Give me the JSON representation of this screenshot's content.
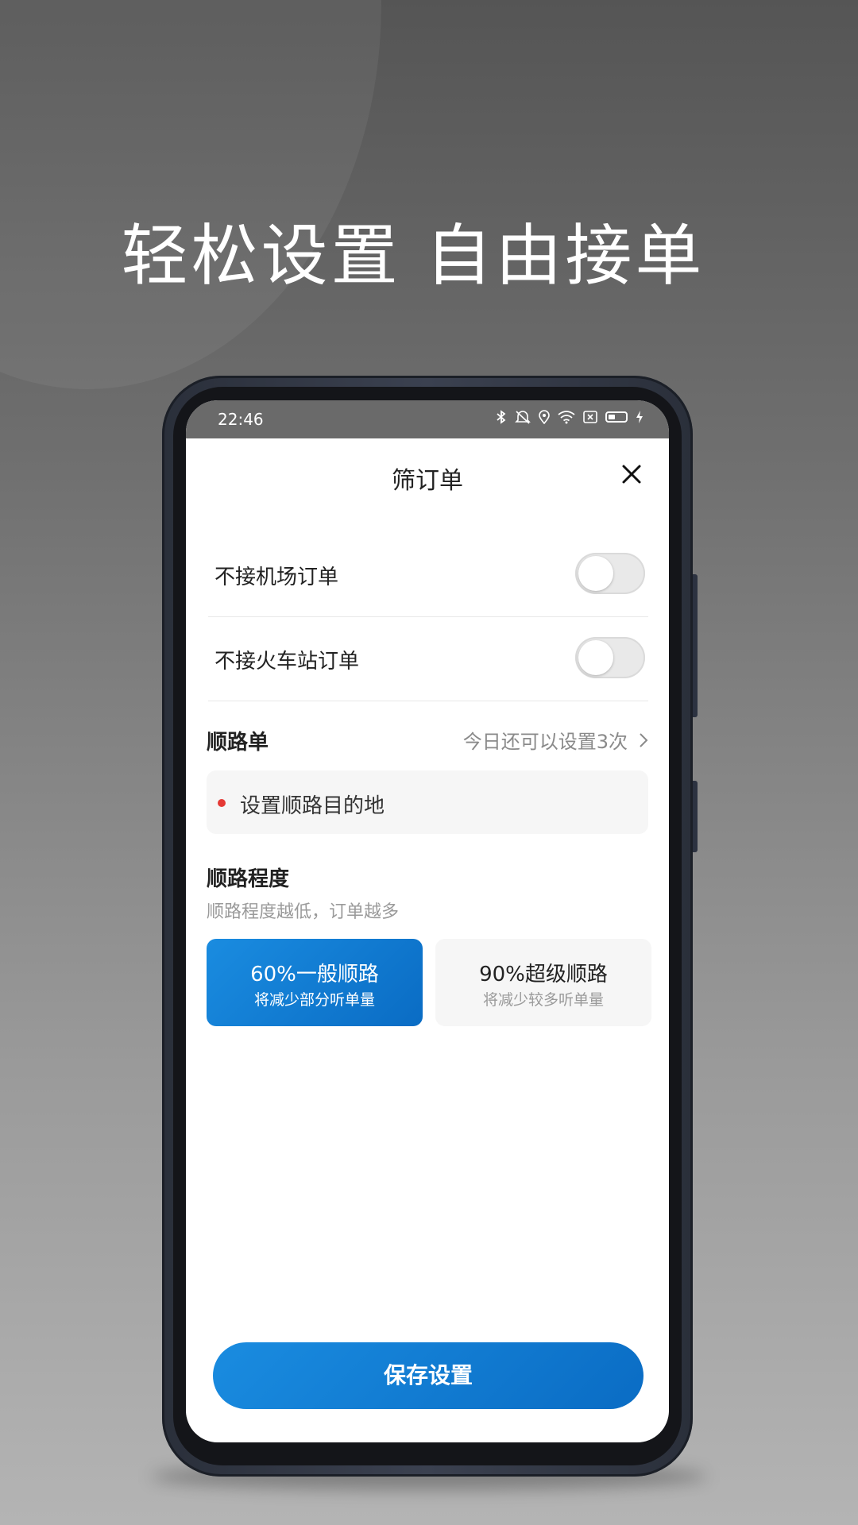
{
  "promo": {
    "headline": "轻松设置 自由接单"
  },
  "statusbar": {
    "time": "22:46",
    "icons": [
      "bluetooth-icon",
      "mute-icon",
      "location-icon",
      "wifi-icon",
      "sim-icon",
      "battery-icon",
      "charging-icon"
    ]
  },
  "screen": {
    "title": "筛订单",
    "close_icon": "close-icon",
    "toggles": [
      {
        "label": "不接机场订单",
        "enabled": false
      },
      {
        "label": "不接火车站订单",
        "enabled": false
      }
    ],
    "shunlu": {
      "title": "顺路单",
      "link_text": "今日还可以设置3次",
      "link_chevron": "›",
      "dest_placeholder": "设置顺路目的地"
    },
    "degree": {
      "title": "顺路程度",
      "subtitle": "顺路程度越低，订单越多",
      "options": [
        {
          "main": "60%一般顺路",
          "sub": "将减少部分听单量",
          "selected": true
        },
        {
          "main": "90%超级顺路",
          "sub": "将减少较多听单量",
          "selected": false
        }
      ]
    },
    "save_label": "保存设置"
  },
  "colors": {
    "accent": "#0a6cc4",
    "accent_light": "#1a8ce0",
    "marker_red": "#e53935"
  }
}
